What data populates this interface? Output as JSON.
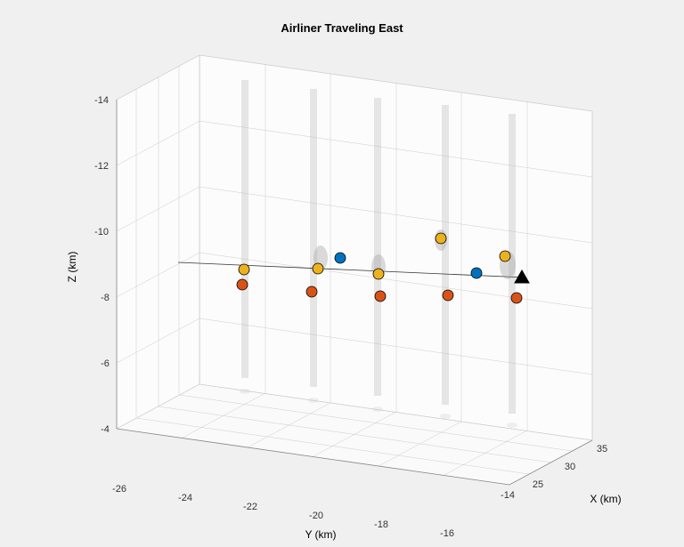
{
  "chart_data": {
    "type": "scatter",
    "title": "Airliner Traveling East",
    "xlabel": "X (km)",
    "ylabel": "Y (km)",
    "zlabel": "Z (km)",
    "x_ticks": [
      25,
      30,
      35
    ],
    "y_ticks": [
      -26,
      -24,
      -22,
      -20,
      -18,
      -16,
      -14
    ],
    "z_ticks": [
      -4,
      -6,
      -8,
      -10,
      -12,
      -14
    ],
    "series": [
      {
        "name": "blue",
        "points": [
          {
            "x": 27,
            "y": -20,
            "z": -9.8
          },
          {
            "x": 33,
            "y": -15,
            "z": -9.5
          }
        ]
      },
      {
        "name": "orange",
        "points": [
          {
            "x": 25,
            "y": -22,
            "z": -9.2
          },
          {
            "x": 27,
            "y": -20,
            "z": -9.4
          },
          {
            "x": 29,
            "y": -18.5,
            "z": -9.3
          },
          {
            "x": 32,
            "y": -17,
            "z": -10.4
          },
          {
            "x": 34,
            "y": -14.5,
            "z": -10.0
          }
        ]
      },
      {
        "name": "red",
        "points": [
          {
            "x": 25,
            "y": -22,
            "z": -8.7
          },
          {
            "x": 27,
            "y": -20,
            "z": -8.6
          },
          {
            "x": 29,
            "y": -18.5,
            "z": -8.5
          },
          {
            "x": 31,
            "y": -16.5,
            "z": -8.4
          },
          {
            "x": 34,
            "y": -14.5,
            "z": -8.2
          }
        ]
      }
    ],
    "marker": {
      "x": 34.5,
      "y": -14,
      "z": -9.4,
      "shape": "triangle"
    },
    "track_line": {
      "from": {
        "x": 24,
        "y": -24,
        "z": -10
      },
      "to": {
        "x": 35,
        "y": -13,
        "z": -9.3
      }
    }
  }
}
